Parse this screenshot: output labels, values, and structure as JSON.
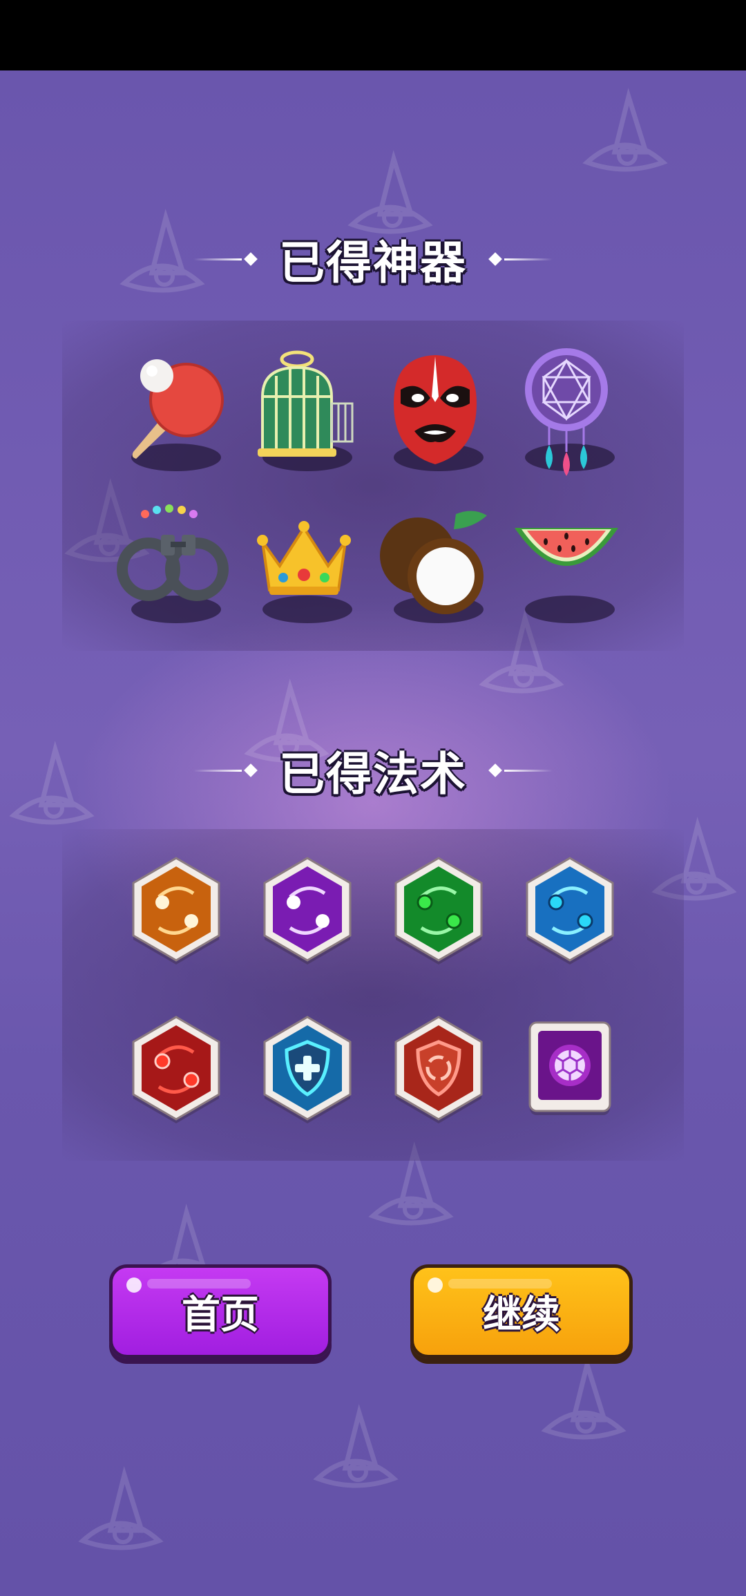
{
  "artifacts_section": {
    "title": "已得神器",
    "items": [
      {
        "icon": "ping-pong-paddle-icon"
      },
      {
        "icon": "birdcage-icon"
      },
      {
        "icon": "opera-mask-icon"
      },
      {
        "icon": "dreamcatcher-icon"
      },
      {
        "icon": "handcuffs-icon"
      },
      {
        "icon": "crown-icon"
      },
      {
        "icon": "coconut-icon"
      },
      {
        "icon": "watermelon-icon"
      }
    ]
  },
  "spells_section": {
    "title": "已得法术",
    "items": [
      {
        "icon": "orange-swap-orbs-icon",
        "color": "#e07a14"
      },
      {
        "icon": "purple-swap-orbs-icon",
        "color": "#8a24c4"
      },
      {
        "icon": "green-swap-orbs-icon",
        "color": "#1d9a35"
      },
      {
        "icon": "blue-swap-orbs-icon",
        "color": "#1b78c8"
      },
      {
        "icon": "red-swap-orbs-icon",
        "color": "#b21b1b"
      },
      {
        "icon": "healing-shield-icon",
        "color": "#1d78b8"
      },
      {
        "icon": "refresh-shield-icon",
        "color": "#b8321b"
      },
      {
        "icon": "turtle-shell-icon",
        "color": "#7a1ab8"
      }
    ]
  },
  "buttons": {
    "home_label": "首页",
    "continue_label": "继续"
  }
}
